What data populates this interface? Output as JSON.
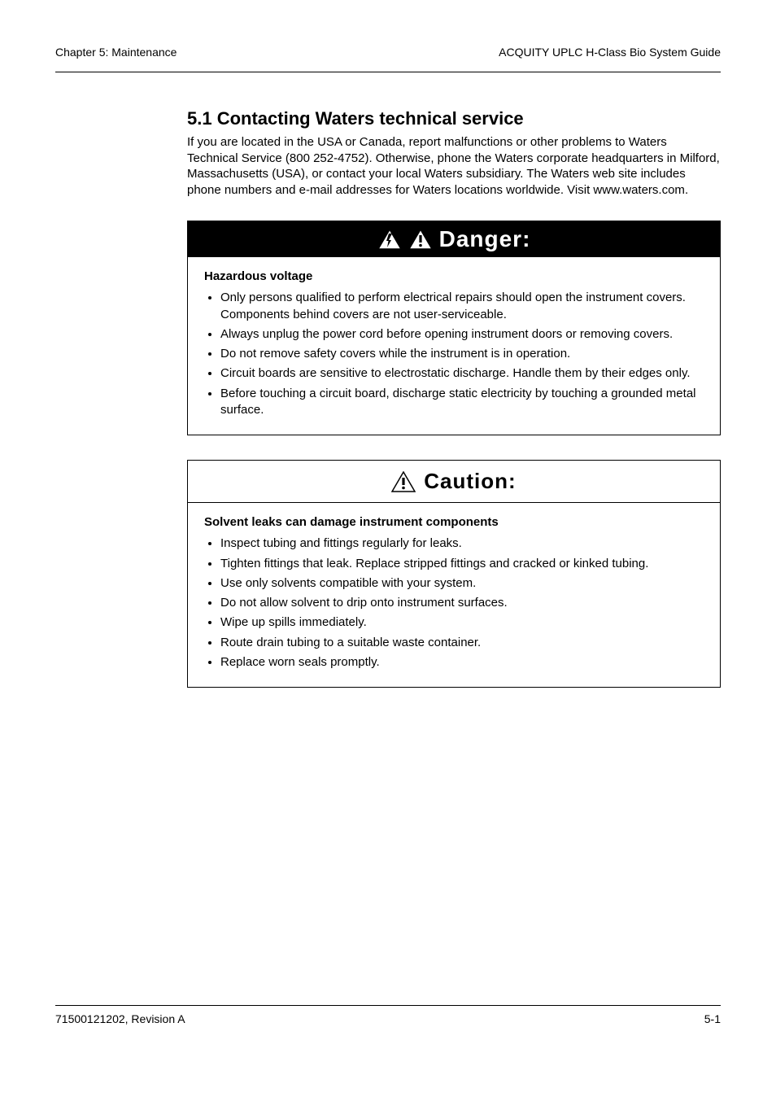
{
  "header": {
    "left": "Chapter 5: Maintenance",
    "right": "ACQUITY UPLC H-Class Bio System Guide"
  },
  "section": {
    "title": "5.1 Contacting Waters technical service",
    "intro_1": "If you are located in the USA or Canada, report malfunctions or other problems to Waters Technical Service (800 252-4752). Otherwise, phone the Waters corporate headquarters in Milford, Massachusetts (USA), or contact your local Waters subsidiary. The Waters web site includes phone numbers and e-mail addresses for Waters locations worldwide. Visit ",
    "intro_link": "www.waters.com",
    "intro_2": "."
  },
  "danger": {
    "label": "Danger:",
    "subhead": "Hazardous voltage",
    "items": [
      "Only persons qualified to perform electrical repairs should open the instrument covers. Components behind covers are not user-serviceable.",
      "Always unplug the power cord before opening instrument doors or removing covers.",
      "Do not remove safety covers while the instrument is in operation.",
      "Circuit boards are sensitive to electrostatic discharge. Handle them by their edges only.",
      "Before touching a circuit board, discharge static electricity by touching a grounded metal surface."
    ]
  },
  "caution": {
    "label": "Caution:",
    "subhead": "Solvent leaks can damage instrument components",
    "items": [
      "Inspect tubing and fittings regularly for leaks.",
      "Tighten fittings that leak. Replace stripped fittings and cracked or kinked tubing.",
      "Use only solvents compatible with your system.",
      "Do not allow solvent to drip onto instrument surfaces.",
      "Wipe up spills immediately.",
      "Route drain tubing to a suitable waste container.",
      "Replace worn seals promptly."
    ]
  },
  "footer": {
    "left": "71500121202, Revision A",
    "right": "5-1"
  }
}
